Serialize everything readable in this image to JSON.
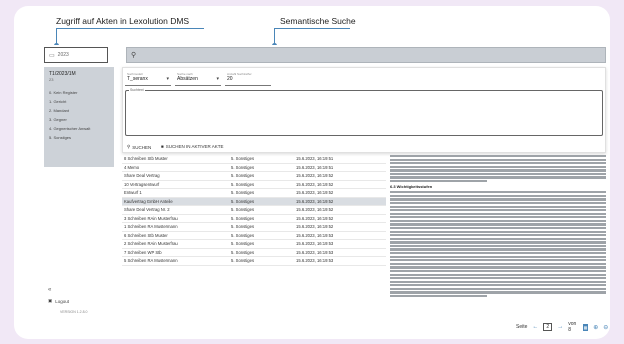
{
  "annotations": {
    "left": "Zugriff auf Akten in Lexolution DMS",
    "right": "Semantische Suche"
  },
  "context_box": {
    "value": "2023"
  },
  "sidebar": {
    "title": "T1/2023/1M",
    "subtitle": "23",
    "items": [
      "0. Kein Register",
      "1. Gericht",
      "2. Mandant",
      "3. Gegner",
      "4. Gegnerischer Anwalt",
      "5. Sonstiges"
    ],
    "logout": "Logout",
    "version": "VERSION 1.2.8.0"
  },
  "search_panel": {
    "selects": [
      {
        "label": "Suchmodell",
        "value": "T_seranx"
      },
      {
        "label": "Suche nach",
        "value": "Absätzen"
      },
      {
        "label": "Anzahl Suchtreffer",
        "value": "20"
      }
    ],
    "textarea_label": "Suchtext",
    "buttons": {
      "search": "SUCHEN",
      "search_active": "SUCHEN IN AKTIVER AKTE"
    }
  },
  "table": {
    "rows": [
      [
        "8 Schreiben Stb Muster",
        "5. Sonstiges",
        "15.6.2023, 16:19:51"
      ],
      [
        "4 Memo",
        "5. Sonstiges",
        "15.6.2023, 16:19:51"
      ],
      [
        "Share Deal Vertrag",
        "5. Sonstiges",
        "15.6.2023, 16:19:52"
      ],
      [
        "10 Vertragsentwurf",
        "5. Sonstiges",
        "15.6.2023, 16:19:52"
      ],
      [
        "Entwurf 1",
        "5. Sonstiges",
        "15.6.2023, 16:19:52"
      ],
      [
        "Kaufvertrag GmbH Anteile",
        "5. Sonstiges",
        "15.6.2023, 16:19:52"
      ],
      [
        "Share Deal Vertrag Nr. 2",
        "5. Sonstiges",
        "15.6.2023, 16:19:52"
      ],
      [
        "3 Schreiben RAin Musterfrau",
        "5. Sonstiges",
        "15.6.2023, 16:19:52"
      ],
      [
        "1 Schreiben RA Mustermann",
        "5. Sonstiges",
        "15.6.2023, 16:19:52"
      ],
      [
        "6 Schreiben Stb Muster",
        "5. Sonstiges",
        "15.6.2023, 16:19:53"
      ],
      [
        "2 Schreiben RAin Musterfrau",
        "5. Sonstiges",
        "15.6.2023, 16:19:53"
      ],
      [
        "7 Schreiben WP Stb",
        "5. Sonstiges",
        "15.6.2023, 16:19:53"
      ],
      [
        "5 Schreiben RA Mustermann",
        "5. Sonstiges",
        "15.6.2023, 16:19:53"
      ]
    ],
    "selected_index": 5
  },
  "document": {
    "heading": "6.3 Wichtigkeitsstufen"
  },
  "pager": {
    "label": "Seite",
    "page": "2",
    "of": "von 8"
  }
}
